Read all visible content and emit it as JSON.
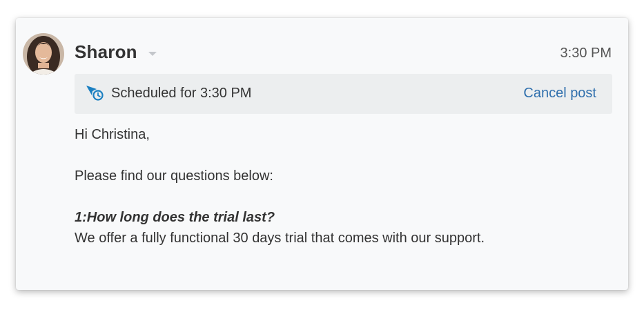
{
  "message": {
    "sender": "Sharon",
    "time": "3:30 PM",
    "scheduled": {
      "text": "Scheduled for 3:30 PM",
      "cancel_label": "Cancel post",
      "icon": "scheduled-send-icon",
      "icon_color": "#1a7fc1"
    },
    "body": {
      "greeting": "Hi Christina,",
      "intro": "Please find our questions below:",
      "question": "1:How long does the trial last?",
      "answer": "We offer a fully functional 30 days trial that comes with our support."
    }
  }
}
